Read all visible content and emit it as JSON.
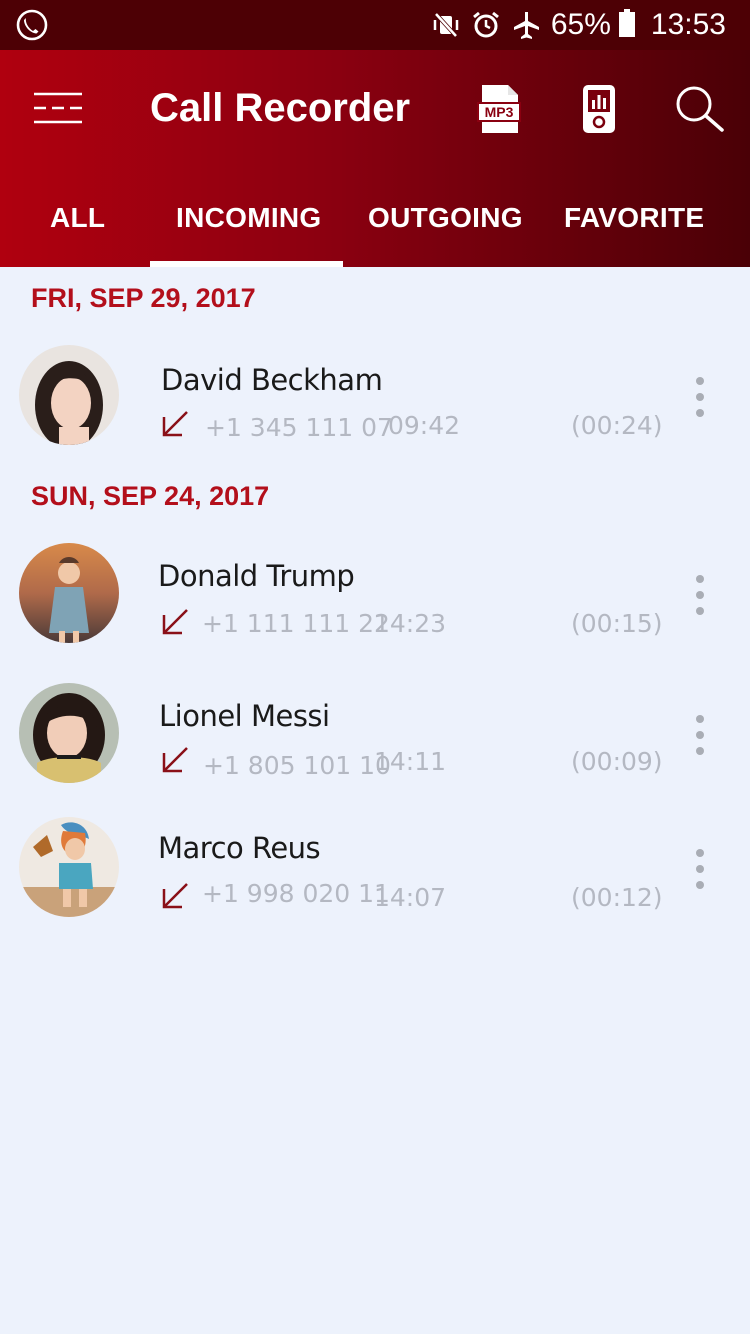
{
  "status_bar": {
    "battery_percent": "65%",
    "time": "13:53"
  },
  "app_bar": {
    "title": "Call Recorder",
    "mp3_label": "MP3",
    "tabs": [
      {
        "label": "ALL",
        "active": false
      },
      {
        "label": "INCOMING",
        "active": true
      },
      {
        "label": "OUTGOING",
        "active": false
      },
      {
        "label": "FAVORITE",
        "active": false
      }
    ]
  },
  "colors": {
    "status_bar_bg": "#4d0005",
    "app_bar_start": "#b0000f",
    "app_bar_end": "#4a0006",
    "date_header": "#b30f1b",
    "list_background": "#edf2fc",
    "incoming_arrow": "#8a1018"
  },
  "groups": [
    {
      "date": "FRI, SEP 29, 2017",
      "calls": [
        {
          "name": "David Beckham",
          "phone": "+1 345 111 07",
          "time": "09:42",
          "duration": "(00:24)",
          "direction_icon": "incoming-arrow-icon"
        }
      ]
    },
    {
      "date": "SUN, SEP 24, 2017",
      "calls": [
        {
          "name": "Donald Trump",
          "phone": "+1 111 111 22",
          "time": "14:23",
          "duration": "(00:15)",
          "direction_icon": "incoming-arrow-icon"
        },
        {
          "name": "Lionel Messi",
          "phone": "+1 805 101 10",
          "time": "14:11",
          "duration": "(00:09)",
          "direction_icon": "incoming-arrow-icon"
        },
        {
          "name": "Marco Reus",
          "phone": "+1 998 020 11",
          "time": "14:07",
          "duration": "(00:12)",
          "direction_icon": "incoming-arrow-icon"
        }
      ]
    }
  ]
}
